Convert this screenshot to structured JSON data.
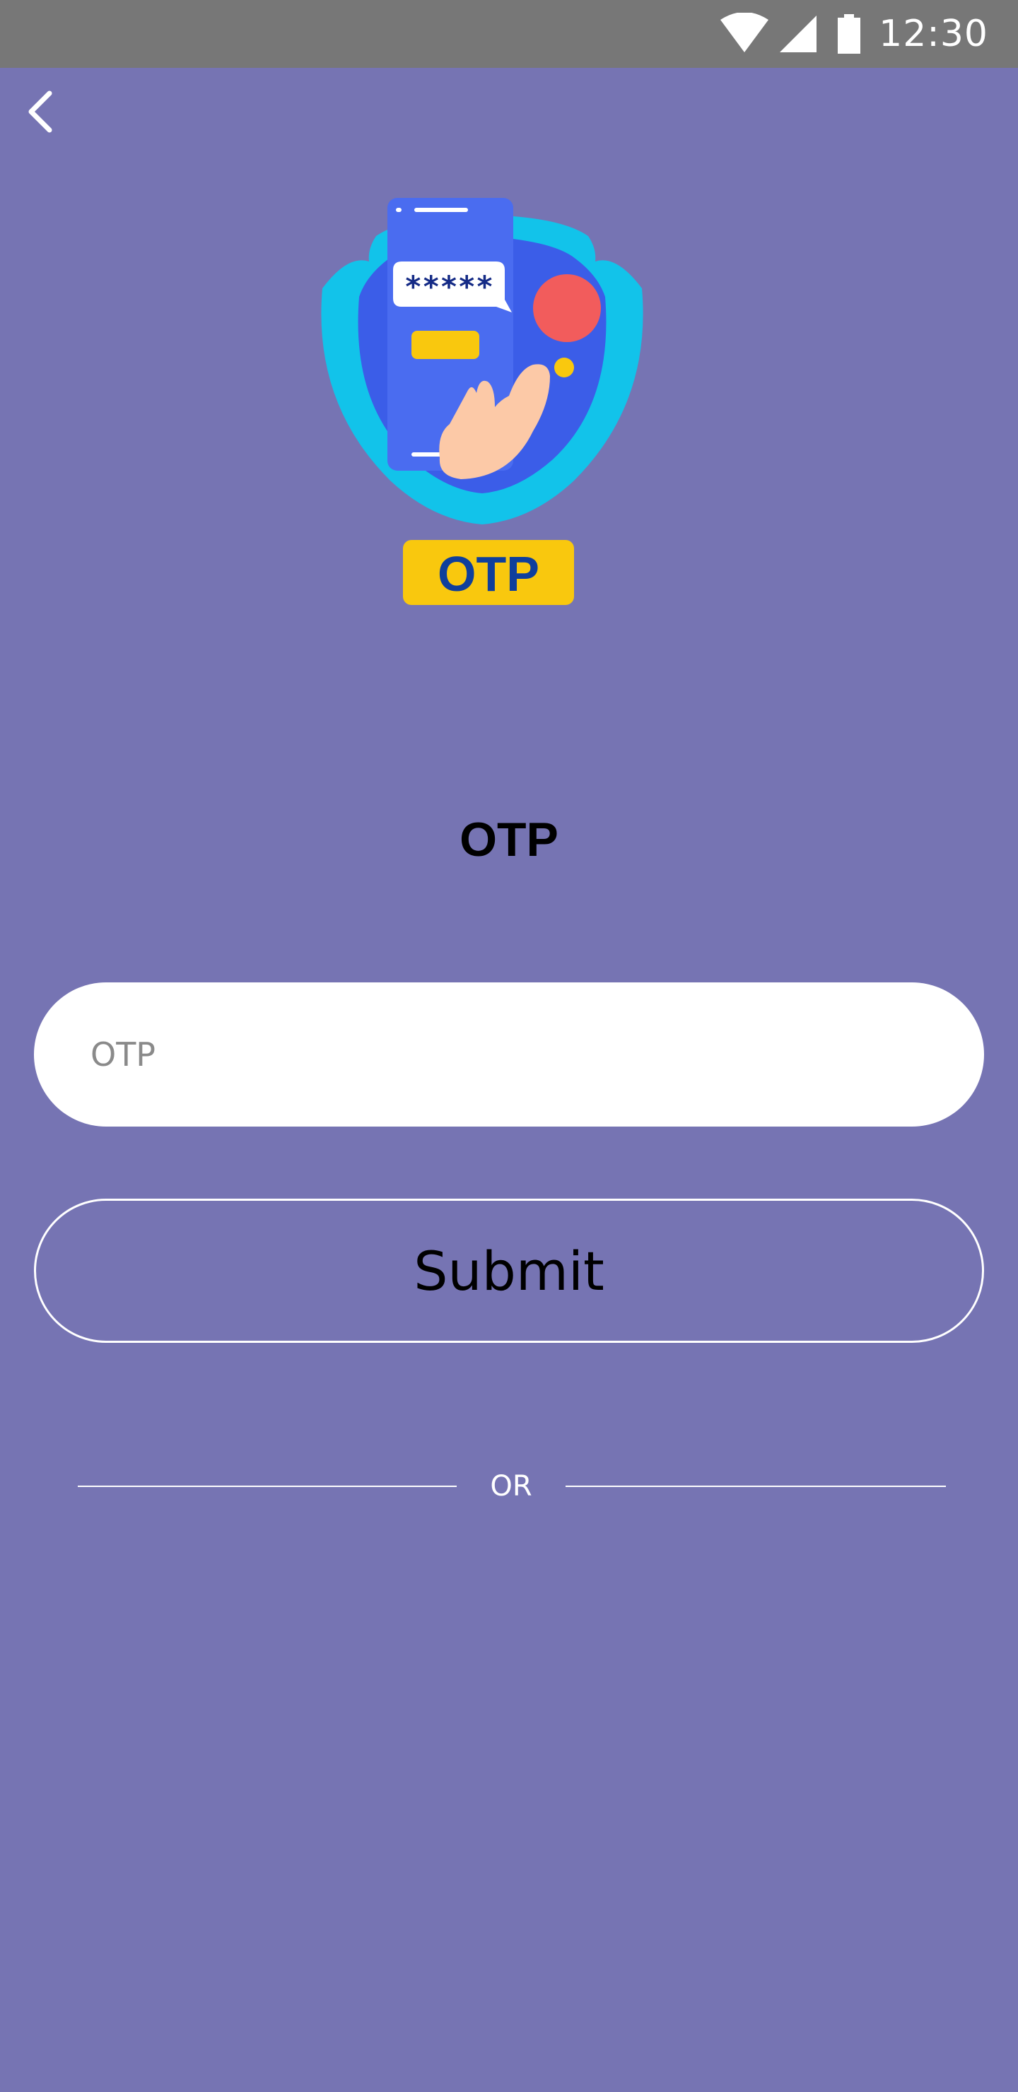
{
  "status_bar": {
    "time": "12:30",
    "wifi_icon": "wifi-icon",
    "signal_icon": "cell-signal-icon",
    "battery_icon": "battery-icon"
  },
  "nav": {
    "back_icon": "chevron-left-icon"
  },
  "illustration": {
    "masked_code": "*****",
    "badge_text": "OTP"
  },
  "page": {
    "title": "OTP"
  },
  "form": {
    "otp_placeholder": "OTP",
    "otp_value": "",
    "submit_label": "Submit",
    "divider_text": "OR"
  },
  "colors": {
    "background": "#7674b3",
    "status_bar": "#777777",
    "input_background": "#ffffff",
    "button_border": "#ffffff",
    "shield": "#12c3ea",
    "phone": "#4a6cf0",
    "badge": "#f9c80e",
    "badge_text": "#0f3f9c",
    "accent_red": "#f25c5c"
  }
}
